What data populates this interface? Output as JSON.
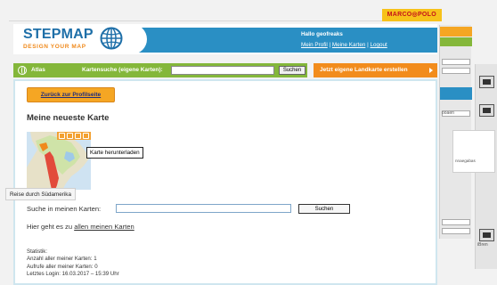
{
  "brand": {
    "partner": "MARCO◎POLO",
    "logo_main": "STEPMAP",
    "logo_sub": "DESIGN YOUR MAP"
  },
  "user": {
    "greeting": "Hallo geofreaks",
    "link_profile": "Mein Profil",
    "separator1": " | ",
    "link_maps": "Meine Karten",
    "separator2": " | ",
    "link_logout": "Logout"
  },
  "nav": {
    "atlas": "Atlas",
    "search_label": "Kartensuche (eigene Karten):",
    "search_value": "",
    "search_button": "Suchen",
    "create_label": "Jetzt eigene Landkarte erstellen"
  },
  "main": {
    "back_button": "Zurück zur Profilseite",
    "title": "Meine neueste Karte",
    "tooltip": "Karte herunterladen",
    "caption": "Reise durch Südamerika",
    "search_label": "Suche in meinen Karten:",
    "search_value": "",
    "search_button": "Suchen",
    "goto_prefix": "Hier geht es zu ",
    "goto_link": "allen meinen Karten",
    "stats": {
      "heading": "Statistik:",
      "maps_count": "Anzahl aller meiner Karten: 1",
      "views": "Aufrufe aller meiner Karten: 0",
      "last_login": "Letztes Login: 16.03.2017 – 15:39 Uhr"
    }
  },
  "ghost": {
    "t1": "ooaen",
    "t2": "nnaegabas",
    "t3": "iBren"
  },
  "colors": {
    "header_blue": "#2a8fc4",
    "nav_green": "#84b73a",
    "create_orange": "#f28c1c",
    "button_orange": "#f5a623",
    "brand_blue": "#1e6fa8"
  }
}
